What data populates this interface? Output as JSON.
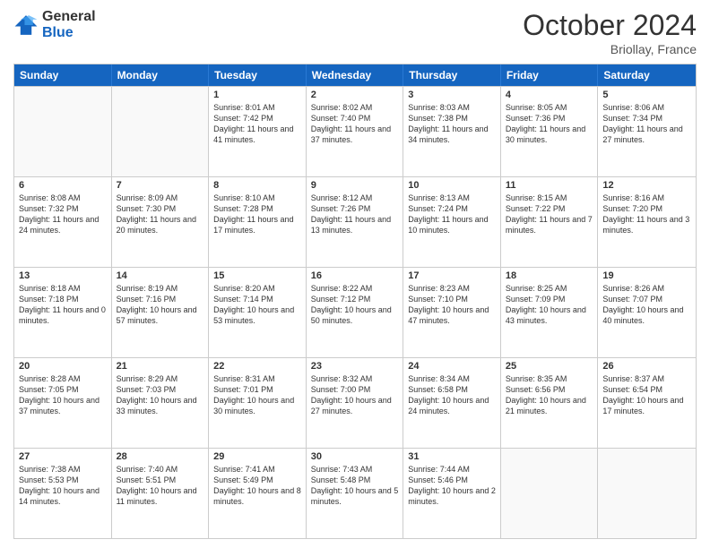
{
  "header": {
    "logo_line1": "General",
    "logo_line2": "Blue",
    "month_title": "October 2024",
    "location": "Briollay, France"
  },
  "day_headers": [
    "Sunday",
    "Monday",
    "Tuesday",
    "Wednesday",
    "Thursday",
    "Friday",
    "Saturday"
  ],
  "weeks": [
    [
      {
        "num": "",
        "sunrise": "",
        "sunset": "",
        "daylight": "",
        "empty": true
      },
      {
        "num": "",
        "sunrise": "",
        "sunset": "",
        "daylight": "",
        "empty": true
      },
      {
        "num": "1",
        "sunrise": "Sunrise: 8:01 AM",
        "sunset": "Sunset: 7:42 PM",
        "daylight": "Daylight: 11 hours and 41 minutes."
      },
      {
        "num": "2",
        "sunrise": "Sunrise: 8:02 AM",
        "sunset": "Sunset: 7:40 PM",
        "daylight": "Daylight: 11 hours and 37 minutes."
      },
      {
        "num": "3",
        "sunrise": "Sunrise: 8:03 AM",
        "sunset": "Sunset: 7:38 PM",
        "daylight": "Daylight: 11 hours and 34 minutes."
      },
      {
        "num": "4",
        "sunrise": "Sunrise: 8:05 AM",
        "sunset": "Sunset: 7:36 PM",
        "daylight": "Daylight: 11 hours and 30 minutes."
      },
      {
        "num": "5",
        "sunrise": "Sunrise: 8:06 AM",
        "sunset": "Sunset: 7:34 PM",
        "daylight": "Daylight: 11 hours and 27 minutes."
      }
    ],
    [
      {
        "num": "6",
        "sunrise": "Sunrise: 8:08 AM",
        "sunset": "Sunset: 7:32 PM",
        "daylight": "Daylight: 11 hours and 24 minutes."
      },
      {
        "num": "7",
        "sunrise": "Sunrise: 8:09 AM",
        "sunset": "Sunset: 7:30 PM",
        "daylight": "Daylight: 11 hours and 20 minutes."
      },
      {
        "num": "8",
        "sunrise": "Sunrise: 8:10 AM",
        "sunset": "Sunset: 7:28 PM",
        "daylight": "Daylight: 11 hours and 17 minutes."
      },
      {
        "num": "9",
        "sunrise": "Sunrise: 8:12 AM",
        "sunset": "Sunset: 7:26 PM",
        "daylight": "Daylight: 11 hours and 13 minutes."
      },
      {
        "num": "10",
        "sunrise": "Sunrise: 8:13 AM",
        "sunset": "Sunset: 7:24 PM",
        "daylight": "Daylight: 11 hours and 10 minutes."
      },
      {
        "num": "11",
        "sunrise": "Sunrise: 8:15 AM",
        "sunset": "Sunset: 7:22 PM",
        "daylight": "Daylight: 11 hours and 7 minutes."
      },
      {
        "num": "12",
        "sunrise": "Sunrise: 8:16 AM",
        "sunset": "Sunset: 7:20 PM",
        "daylight": "Daylight: 11 hours and 3 minutes."
      }
    ],
    [
      {
        "num": "13",
        "sunrise": "Sunrise: 8:18 AM",
        "sunset": "Sunset: 7:18 PM",
        "daylight": "Daylight: 11 hours and 0 minutes."
      },
      {
        "num": "14",
        "sunrise": "Sunrise: 8:19 AM",
        "sunset": "Sunset: 7:16 PM",
        "daylight": "Daylight: 10 hours and 57 minutes."
      },
      {
        "num": "15",
        "sunrise": "Sunrise: 8:20 AM",
        "sunset": "Sunset: 7:14 PM",
        "daylight": "Daylight: 10 hours and 53 minutes."
      },
      {
        "num": "16",
        "sunrise": "Sunrise: 8:22 AM",
        "sunset": "Sunset: 7:12 PM",
        "daylight": "Daylight: 10 hours and 50 minutes."
      },
      {
        "num": "17",
        "sunrise": "Sunrise: 8:23 AM",
        "sunset": "Sunset: 7:10 PM",
        "daylight": "Daylight: 10 hours and 47 minutes."
      },
      {
        "num": "18",
        "sunrise": "Sunrise: 8:25 AM",
        "sunset": "Sunset: 7:09 PM",
        "daylight": "Daylight: 10 hours and 43 minutes."
      },
      {
        "num": "19",
        "sunrise": "Sunrise: 8:26 AM",
        "sunset": "Sunset: 7:07 PM",
        "daylight": "Daylight: 10 hours and 40 minutes."
      }
    ],
    [
      {
        "num": "20",
        "sunrise": "Sunrise: 8:28 AM",
        "sunset": "Sunset: 7:05 PM",
        "daylight": "Daylight: 10 hours and 37 minutes."
      },
      {
        "num": "21",
        "sunrise": "Sunrise: 8:29 AM",
        "sunset": "Sunset: 7:03 PM",
        "daylight": "Daylight: 10 hours and 33 minutes."
      },
      {
        "num": "22",
        "sunrise": "Sunrise: 8:31 AM",
        "sunset": "Sunset: 7:01 PM",
        "daylight": "Daylight: 10 hours and 30 minutes."
      },
      {
        "num": "23",
        "sunrise": "Sunrise: 8:32 AM",
        "sunset": "Sunset: 7:00 PM",
        "daylight": "Daylight: 10 hours and 27 minutes."
      },
      {
        "num": "24",
        "sunrise": "Sunrise: 8:34 AM",
        "sunset": "Sunset: 6:58 PM",
        "daylight": "Daylight: 10 hours and 24 minutes."
      },
      {
        "num": "25",
        "sunrise": "Sunrise: 8:35 AM",
        "sunset": "Sunset: 6:56 PM",
        "daylight": "Daylight: 10 hours and 21 minutes."
      },
      {
        "num": "26",
        "sunrise": "Sunrise: 8:37 AM",
        "sunset": "Sunset: 6:54 PM",
        "daylight": "Daylight: 10 hours and 17 minutes."
      }
    ],
    [
      {
        "num": "27",
        "sunrise": "Sunrise: 7:38 AM",
        "sunset": "Sunset: 5:53 PM",
        "daylight": "Daylight: 10 hours and 14 minutes."
      },
      {
        "num": "28",
        "sunrise": "Sunrise: 7:40 AM",
        "sunset": "Sunset: 5:51 PM",
        "daylight": "Daylight: 10 hours and 11 minutes."
      },
      {
        "num": "29",
        "sunrise": "Sunrise: 7:41 AM",
        "sunset": "Sunset: 5:49 PM",
        "daylight": "Daylight: 10 hours and 8 minutes."
      },
      {
        "num": "30",
        "sunrise": "Sunrise: 7:43 AM",
        "sunset": "Sunset: 5:48 PM",
        "daylight": "Daylight: 10 hours and 5 minutes."
      },
      {
        "num": "31",
        "sunrise": "Sunrise: 7:44 AM",
        "sunset": "Sunset: 5:46 PM",
        "daylight": "Daylight: 10 hours and 2 minutes."
      },
      {
        "num": "",
        "sunrise": "",
        "sunset": "",
        "daylight": "",
        "empty": true
      },
      {
        "num": "",
        "sunrise": "",
        "sunset": "",
        "daylight": "",
        "empty": true
      }
    ]
  ]
}
